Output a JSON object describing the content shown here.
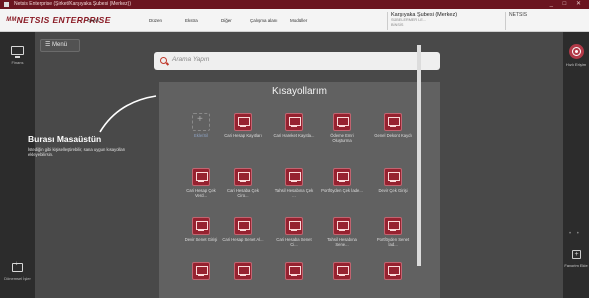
{
  "window": {
    "title": "Netsis Enterprise (Şirket/Karşıyaka Şubesi (Merkez))",
    "controls": "_ □ ✕"
  },
  "menubar": {
    "logo": "ᴹᴹNETSIS ENTERPRISE",
    "items": [
      "Genel",
      "Düzen",
      "Ekstra",
      "Diğer",
      "Çalışma alanı",
      "Modüller"
    ],
    "company_name": "Karşıyaka Şubesi (Merkez)",
    "company_sub1": "SÜBELERMER LE...",
    "company_sub2": "BİNSİS",
    "brand": "NETSIS"
  },
  "leftbar": {
    "top_label": "Finans",
    "bottom_label": "Dönemsel İşler"
  },
  "rightbar": {
    "top_label": "Hızlı Erişim",
    "bottom_label": "Favorim Ekle",
    "dots": "• •"
  },
  "main": {
    "menu_label": "☰  Menü",
    "search_placeholder": "Arama Yapın",
    "welcome_title": "Burası Masaüstün",
    "welcome_text": "İstediğin gibi kişiselleştirebilir, sana uygun kısayolları ekleyebilirsin.",
    "shortcuts_title": "Kısayollarım",
    "shortcuts": [
      {
        "label": "Ekle/Sil",
        "empty": true
      },
      {
        "label": "Cari Hesap Kayıtları",
        "empty": false
      },
      {
        "label": "Cari Hareket Kayıtla...",
        "empty": false
      },
      {
        "label": "Ödeme Emri Oluşturma",
        "empty": false
      },
      {
        "label": "Genel Dekont Kaydı",
        "empty": false
      },
      {
        "label": "Cari Hesap Çek Verd...",
        "empty": false
      },
      {
        "label": "Cari Hesaba Çek Ciro...",
        "empty": false
      },
      {
        "label": "Tahsil Hesabına Çek ...",
        "empty": false
      },
      {
        "label": "Portföyden Çek İade...",
        "empty": false
      },
      {
        "label": "Devir Çek Girişi",
        "empty": false
      },
      {
        "label": "Devir Senet Girişi",
        "empty": false
      },
      {
        "label": "Cari Hesap Senet Al...",
        "empty": false
      },
      {
        "label": "Cari Hesaba Senet Ci...",
        "empty": false
      },
      {
        "label": "Tahsil Hesabına Sene...",
        "empty": false
      },
      {
        "label": "Portföyden Senet İad...",
        "empty": false
      },
      {
        "label": "",
        "empty": false
      },
      {
        "label": "",
        "empty": false
      },
      {
        "label": "",
        "empty": false
      },
      {
        "label": "",
        "empty": false
      },
      {
        "label": "",
        "empty": false
      }
    ]
  },
  "colors": {
    "accent": "#962230",
    "titlebar": "#6b1520",
    "background": "#494949"
  }
}
